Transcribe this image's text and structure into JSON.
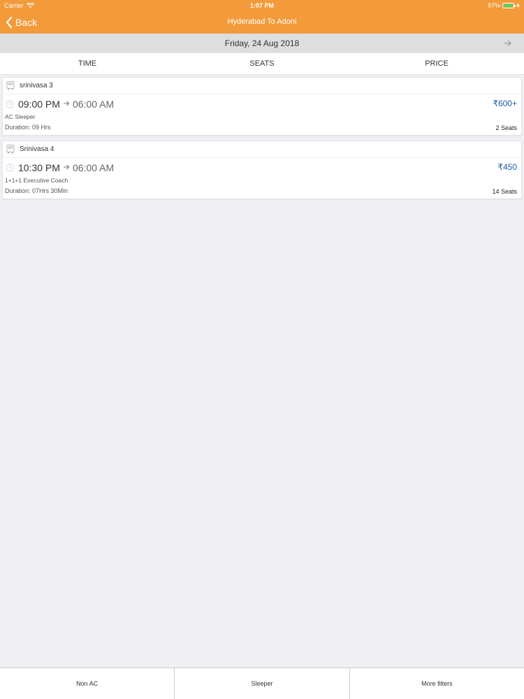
{
  "status_bar": {
    "carrier": "Carrier",
    "time": "1:07 PM",
    "battery": "97%",
    "battery_level": 0.97
  },
  "nav": {
    "back_label": "Back",
    "title": "Hyderabad To Adoni"
  },
  "date_bar": {
    "date": "Friday, 24 Aug 2018"
  },
  "sort_tabs": [
    {
      "label": "TIME"
    },
    {
      "label": "SEATS"
    },
    {
      "label": "PRICE"
    }
  ],
  "buses": [
    {
      "name": "srinivasa 3",
      "departure": "09:00 PM",
      "arrival": "06:00 AM",
      "price": "₹600+",
      "type": "AC Sleeper",
      "duration": "Duration: 09 Hrs",
      "seats": "2 Seats"
    },
    {
      "name": "Srinivasa 4",
      "departure": "10:30 PM",
      "arrival": "06:00 AM",
      "price": "₹450",
      "type": "1+1+1 Executive Coach",
      "duration": "Duration: 07Hrs 30Min",
      "seats": "14 Seats"
    }
  ],
  "filters": [
    {
      "label": "Non AC"
    },
    {
      "label": "Sleeper"
    },
    {
      "label": "More filters"
    }
  ],
  "colors": {
    "header": "#f39a3b",
    "price": "#1a5ba8",
    "background": "#efeff4"
  },
  "icons": {
    "back": "chevron-left-icon",
    "next_date": "arrow-right-icon",
    "bus": "bus-icon",
    "clock": "clock-icon",
    "arrow": "arrow-right-icon",
    "wifi": "wifi-icon",
    "battery": "battery-icon"
  }
}
